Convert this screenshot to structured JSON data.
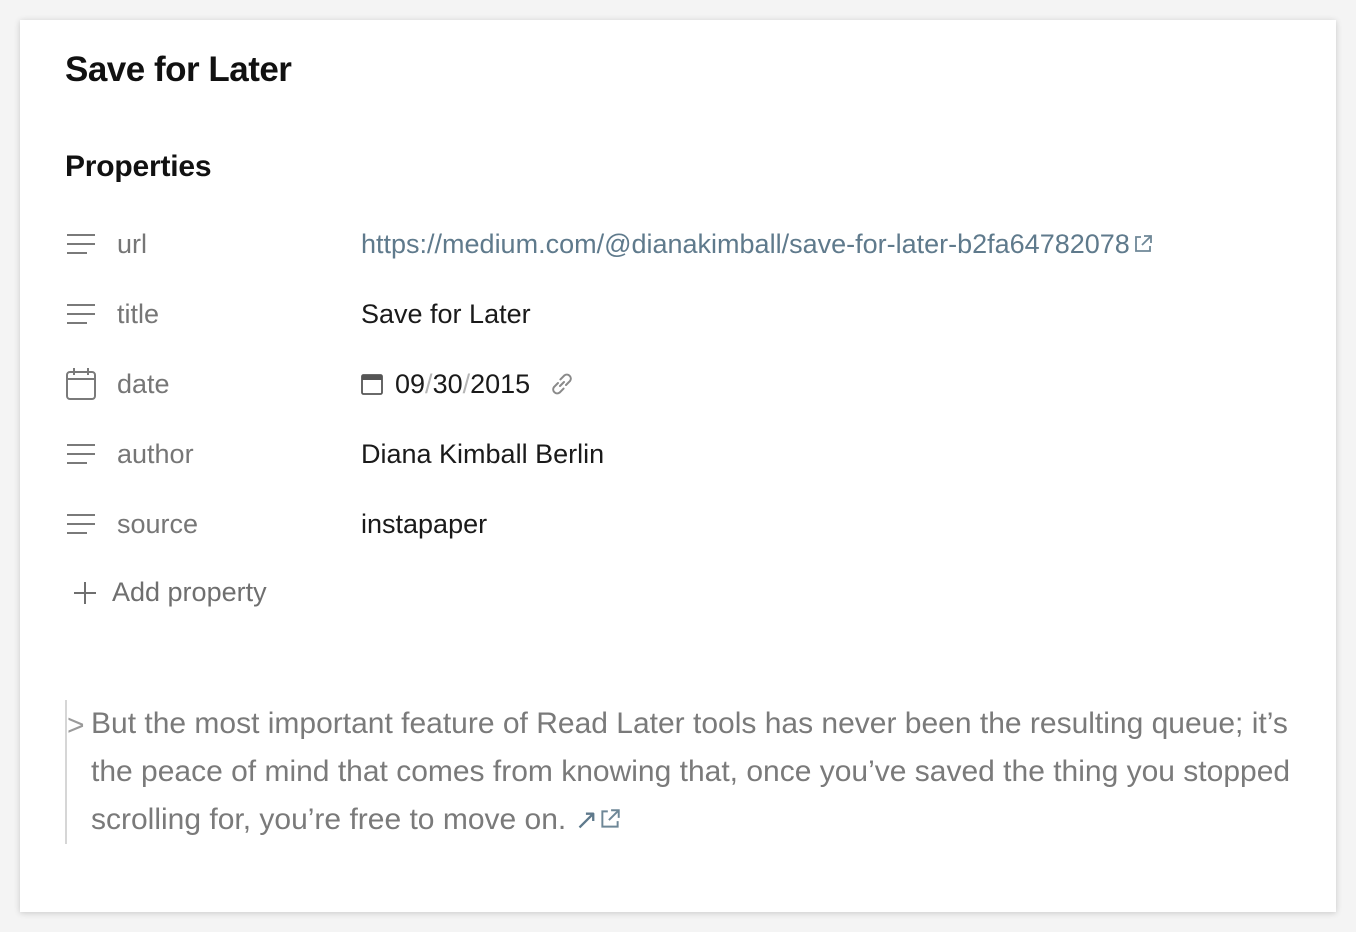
{
  "page": {
    "title": "Save for Later"
  },
  "properties": {
    "heading": "Properties",
    "items": [
      {
        "icon": "text-lines-icon",
        "name": "url",
        "value": "https://medium.com/@dianakimball/save-for-later-b2fa64782078"
      },
      {
        "icon": "text-lines-icon",
        "name": "title",
        "value": "Save for Later"
      },
      {
        "icon": "calendar-icon",
        "name": "date",
        "month": "09",
        "day": "30",
        "year": "2015",
        "separator": "/"
      },
      {
        "icon": "text-lines-icon",
        "name": "author",
        "value": "Diana Kimball Berlin"
      },
      {
        "icon": "text-lines-icon",
        "name": "source",
        "value": "instapaper"
      }
    ],
    "add_label": "Add property"
  },
  "quote": {
    "marker": ">",
    "text": "But the most important feature of Read Later tools has never been the resulting queue; it’s the peace of mind that comes from knowing that, once you’ve saved the thing you stopped scrolling for, you’re free to move on.",
    "link_glyph": "↗"
  },
  "colors": {
    "link": "#5f7a8c",
    "muted": "#767676",
    "text": "#1a1a1a"
  }
}
